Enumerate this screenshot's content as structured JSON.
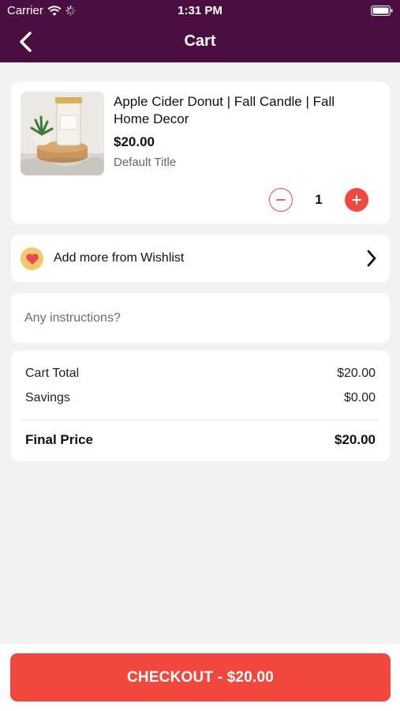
{
  "status_bar": {
    "carrier": "Carrier",
    "time": "1:31 PM"
  },
  "header": {
    "title": "Cart"
  },
  "cart_item": {
    "name": "Apple Cider Donut | Fall Candle | Fall Home Decor",
    "price": "$20.00",
    "variant": "Default Title",
    "quantity": "1"
  },
  "wishlist": {
    "label": "Add more from Wishlist"
  },
  "instructions": {
    "placeholder": "Any instructions?"
  },
  "summary": {
    "cart_total_label": "Cart Total",
    "cart_total_value": "$20.00",
    "savings_label": "Savings",
    "savings_value": "$0.00",
    "final_price_label": "Final Price",
    "final_price_value": "$20.00"
  },
  "checkout": {
    "label": "CHECKOUT - $20.00"
  },
  "colors": {
    "header_bg": "#4a0f40",
    "accent": "#f2473d",
    "heart_bg": "#f5c86a"
  },
  "icons": [
    "wifi-icon",
    "loading-spinner-icon",
    "battery-icon",
    "back-arrow-icon",
    "product-image",
    "minus-icon",
    "plus-icon",
    "heart-icon",
    "chevron-right-icon"
  ]
}
